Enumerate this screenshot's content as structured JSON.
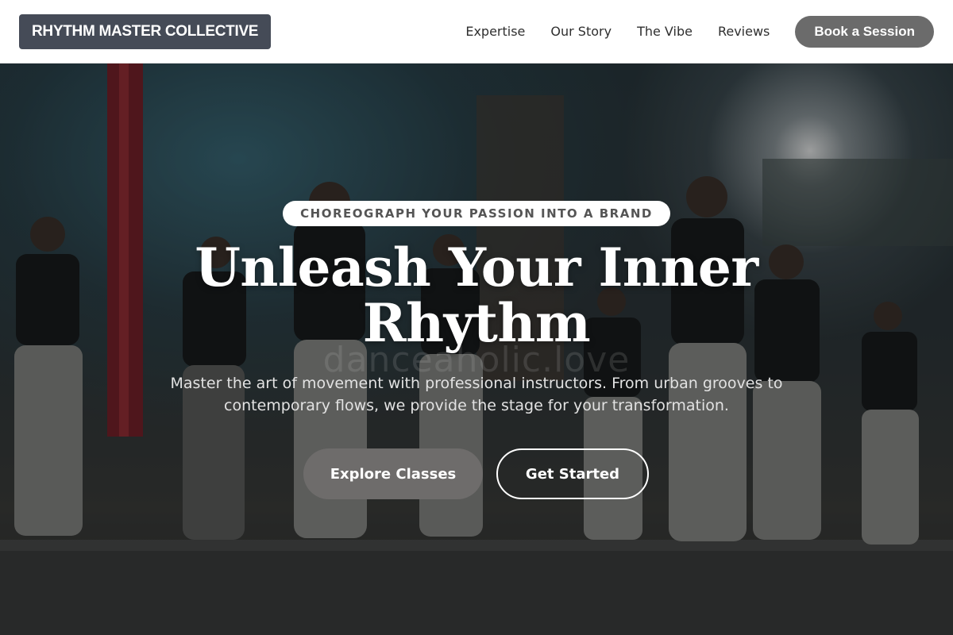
{
  "header": {
    "logo": "RHYTHM MASTER COLLECTIVE",
    "nav": [
      "Expertise",
      "Our Story",
      "The Vibe",
      "Reviews"
    ],
    "cta": "Book a Session"
  },
  "hero": {
    "eyebrow": "CHOREOGRAPH YOUR PASSION INTO A BRAND",
    "title": "Unleash Your Inner Rhythm",
    "watermark": "danceaholic.love",
    "subtitle": "Master the art of movement with professional instructors. From urban grooves to contemporary flows, we provide the stage for your transformation.",
    "primary_button": "Explore Classes",
    "secondary_button": "Get Started",
    "image_alt": "Group of dancers performing on stage"
  },
  "colors": {
    "header_bg": "#ffffff",
    "logo_bg": "#454b57",
    "button_gray": "#6b6b6b",
    "text_dark": "#2f2f2f",
    "curtain_red": "#8a1f2a"
  }
}
